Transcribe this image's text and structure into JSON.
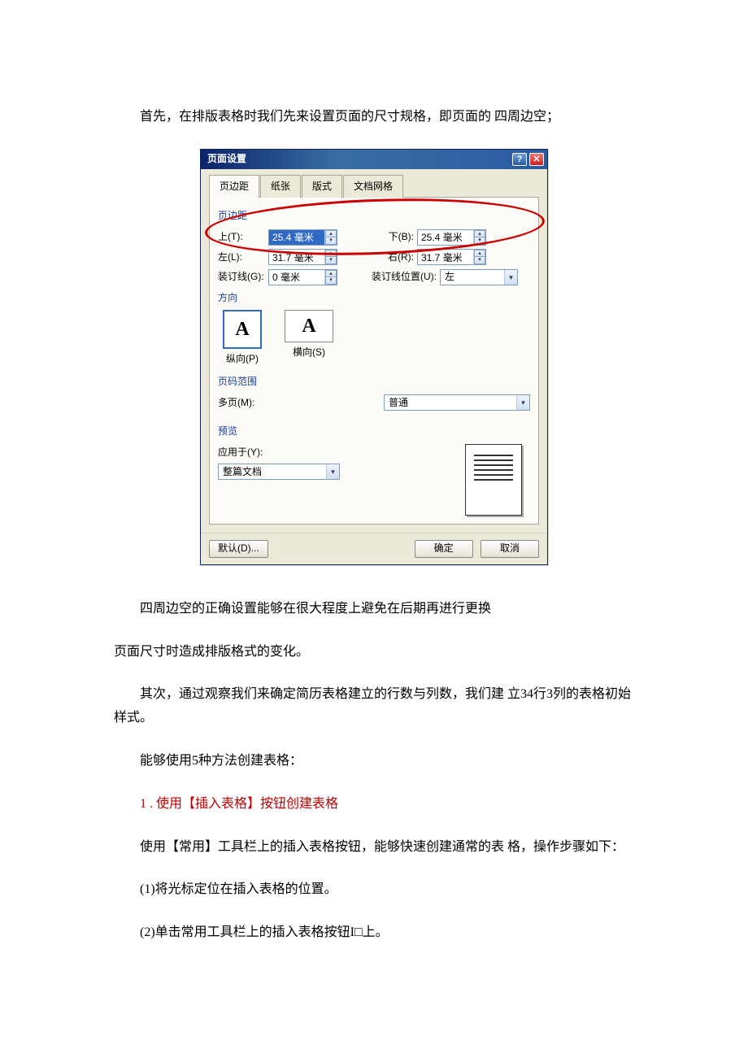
{
  "paragraphs": {
    "p1": "首先，在排版表格时我们先来设置页面的尺寸规格，即页面的 四周边空；",
    "p2": "四周边空的正确设置能够在很大程度上避免在后期再进行更换",
    "p3": "页面尺寸时造成排版格式的变化。",
    "p4": "其次，通过观察我们来确定简历表格建立的行数与列数，我们建  立34行3列的表格初始样式。",
    "p5": "能够使用5种方法创建表格：",
    "h1": "1 . 使用【插入表格】按钮创建表格",
    "p6": "使用【常用】工具栏上的插入表格按钮，能够快速创建通常的表 格，操作步骤如下：",
    "p7": "(1)将光标定位在插入表格的位置。",
    "p8": "(2)单击常用工具栏上的插入表格按钮I□上。"
  },
  "dialog": {
    "title": "页面设置",
    "tabs": [
      "页边距",
      "纸张",
      "版式",
      "文档网格"
    ],
    "group_margin": "页边距",
    "labels": {
      "top": "上(T):",
      "bottom": "下(B):",
      "left": "左(L):",
      "right": "右(R):",
      "gutter": "装订线(G):",
      "gutter_pos": "装订线位置(U):"
    },
    "values": {
      "top": "25.4 毫米",
      "bottom": "25.4 毫米",
      "left": "31.7 毫米",
      "right": "31.7 毫米",
      "gutter": "0 毫米",
      "gutter_pos": "左"
    },
    "group_orient": "方向",
    "orient": {
      "portrait": "纵向(P)",
      "landscape": "横向(S)",
      "glyph": "A"
    },
    "group_range": "页码范围",
    "range_label": "多页(M):",
    "range_value": "普通",
    "group_preview": "预览",
    "apply_label": "应用于(Y):",
    "apply_value": "整篇文档",
    "buttons": {
      "default": "默认(D)...",
      "ok": "确定",
      "cancel": "取消"
    },
    "help_glyph": "?",
    "close_glyph": "✕",
    "spin_up": "▴",
    "spin_down": "▾",
    "dropdown_arrow": "▾"
  }
}
